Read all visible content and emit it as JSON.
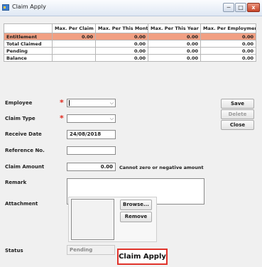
{
  "window": {
    "title": "Claim Apply",
    "controls": {
      "minimize": "─",
      "maximize": "□",
      "close": "x"
    }
  },
  "summary_table": {
    "headers": [
      "",
      "Max. Per Claim",
      "Max. Per This Month",
      "Max. Per This Year",
      "Max. Per Employment"
    ],
    "rows": [
      {
        "label": "Entitlement",
        "values": [
          "0.00",
          "0.00",
          "0.00",
          "0.00"
        ],
        "highlight": true
      },
      {
        "label": "Total Claimed",
        "values": [
          "",
          "0.00",
          "0.00",
          "0.00"
        ],
        "highlight": false
      },
      {
        "label": "Pending",
        "values": [
          "",
          "0.00",
          "0.00",
          "0.00"
        ],
        "highlight": false
      },
      {
        "label": "Balance",
        "values": [
          "",
          "0.00",
          "0.00",
          "0.00"
        ],
        "highlight": false
      }
    ],
    "highlight_color": "#f1a083"
  },
  "form": {
    "employee_label": "Employee",
    "employee_value": "",
    "claim_type_label": "Claim Type",
    "claim_type_value": "",
    "required_mark": "*",
    "receive_date_label": "Receive Date",
    "receive_date_value": "24/08/2018",
    "reference_label": "Reference No.",
    "reference_value": "",
    "claim_amount_label": "Claim Amount",
    "claim_amount_value": "0.00",
    "claim_amount_note": "Cannot zero or negative amount",
    "remark_label": "Remark",
    "remark_value": "",
    "attachment_label": "Attachment",
    "browse_label": "Browse...",
    "remove_label": "Remove",
    "status_label": "Status",
    "status_value": "Pending",
    "dropdown_caret": "⌵"
  },
  "actions": {
    "save_label": "Save",
    "delete_label": "Delete",
    "close_label": "Close"
  },
  "caption": "Claim Apply",
  "colors": {
    "required": "#e0261b",
    "caption_border": "#e0322a"
  }
}
